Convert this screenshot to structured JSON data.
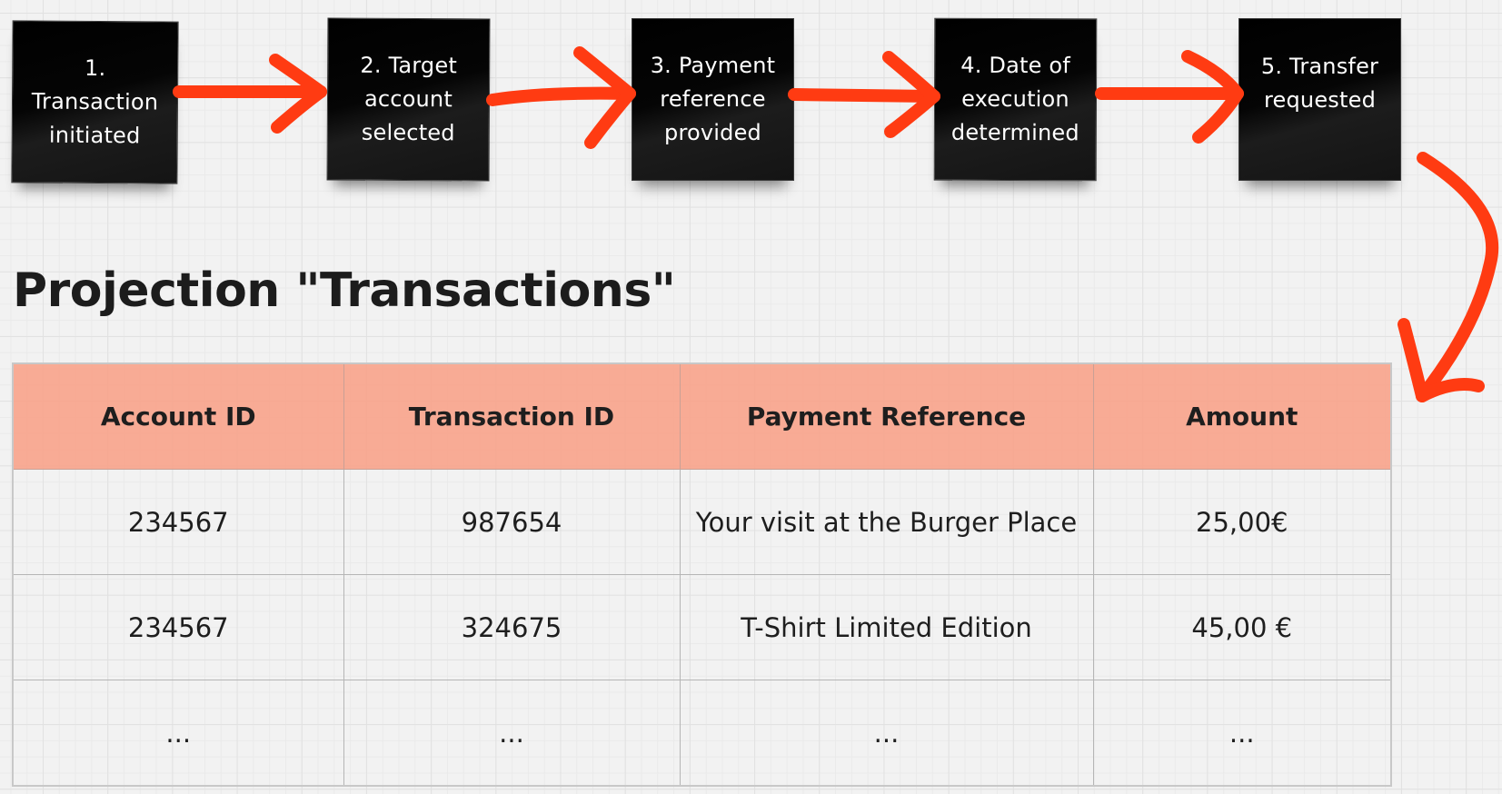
{
  "flow": {
    "steps": [
      {
        "label": "1. Transaction initiated"
      },
      {
        "label": "2. Target account selected"
      },
      {
        "label": "3. Payment reference provided"
      },
      {
        "label": "4. Date of execution determined"
      },
      {
        "label": "5. Transfer requested"
      }
    ],
    "arrow_color": "#ff3b12",
    "note_color": "#000000"
  },
  "projection": {
    "title": "Projection \"Transactions\"",
    "header_color": "#f7a48d",
    "columns": [
      "Account ID",
      "Transaction ID",
      "Payment Reference",
      "Amount"
    ],
    "rows": [
      [
        "234567",
        "987654",
        "Your visit at the Burger Place",
        "25,00€"
      ],
      [
        "234567",
        "324675",
        "T-Shirt Limited Edition",
        "45,00 €"
      ],
      [
        "...",
        "...",
        "...",
        "..."
      ]
    ]
  }
}
